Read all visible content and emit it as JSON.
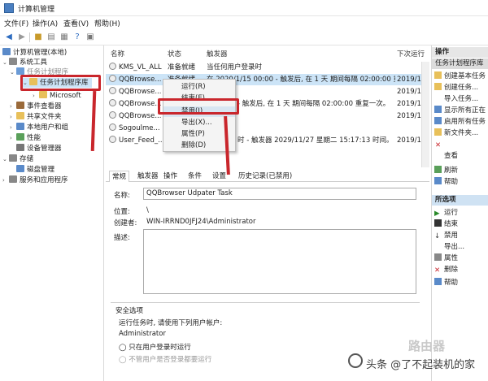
{
  "window": {
    "title": "计算机管理"
  },
  "menu": [
    "文件(F)",
    "操作(A)",
    "查看(V)",
    "帮助(H)"
  ],
  "tree": {
    "root": "计算机管理(本地)",
    "system_tools": "系统工具",
    "task_scheduler": "任务计划程序",
    "task_lib": "任务计划程序库",
    "microsoft": "Microsoft",
    "event_viewer": "事件查看器",
    "shared_folders": "共享文件夹",
    "local_users": "本地用户和组",
    "performance": "性能",
    "device_manager": "设备管理器",
    "storage": "存储",
    "disk_mgmt": "磁盘管理",
    "services": "服务和应用程序"
  },
  "columns": {
    "name": "名称",
    "status": "状态",
    "triggers": "触发器",
    "next_run": "下次运行"
  },
  "tasks": [
    {
      "name": "KMS_VL_ALL",
      "status": "准备就绪",
      "trigger": "当任何用户登录时",
      "next": ""
    },
    {
      "name": "QQBrowse...",
      "status": "准备就绪",
      "trigger": "在 2020/1/15 00:00 - 触发后, 在 1 天 期间每隔 02:00:00 重复一次。",
      "next": "2019/11"
    },
    {
      "name": "QQBrowse...",
      "status": "",
      "trigger": "",
      "next": "2019/11"
    },
    {
      "name": "QQBrowse...",
      "status": "",
      "trigger": "- 触发后, 在 1 天 期间每隔 02:00:00 重复一次。",
      "next": "2019/11"
    },
    {
      "name": "QQBrowse...",
      "status": "",
      "trigger": "",
      "next": "2019/11"
    },
    {
      "name": "Sogoulme...",
      "status": "",
      "trigger": "",
      "next": ""
    },
    {
      "name": "User_Feed_...",
      "status": "",
      "trigger": "时 - 触发器 2029/11/27 星期二 15:17:13 时间。",
      "next": "2019/11"
    }
  ],
  "context_menu": [
    "运行(R)",
    "结束(E)",
    "禁用(I)",
    "导出(X)...",
    "属性(P)",
    "删除(D)"
  ],
  "tabs": [
    "常规",
    "触发器",
    "操作",
    "条件",
    "设置",
    "历史记录(已禁用)"
  ],
  "detail": {
    "name_label": "名称:",
    "name_value": "QQBrowser Udpater Task",
    "location_label": "位置:",
    "location_value": "\\",
    "author_label": "创建者:",
    "author_value": "WIN-IRRND0JFJ24\\Administrator",
    "desc_label": "描述:",
    "security_title": "安全选项",
    "security_desc": "运行任务时, 请使用下列用户帐户:",
    "security_user": "Administrator",
    "only_logged": "只在用户登录时运行",
    "not_logged": "不管用户是否登录都要运行"
  },
  "actions": {
    "head1": "操作",
    "head1_sub": "任务计划程序库",
    "group1": [
      "创建基本任务",
      "创建任务...",
      "导入任务...",
      "显示所有正在",
      "启用所有任务",
      "新文件夹...",
      "查看",
      "刷新",
      "帮助"
    ],
    "head2": "所选项",
    "group2": [
      "运行",
      "结束",
      "禁用",
      "导出...",
      "属性",
      "删除",
      "帮助"
    ]
  },
  "watermark": {
    "text": "头条 @了不起装机的家",
    "router": "路由器"
  },
  "colors": {
    "highlight": "#c9262c",
    "selection": "#cce4f7"
  }
}
